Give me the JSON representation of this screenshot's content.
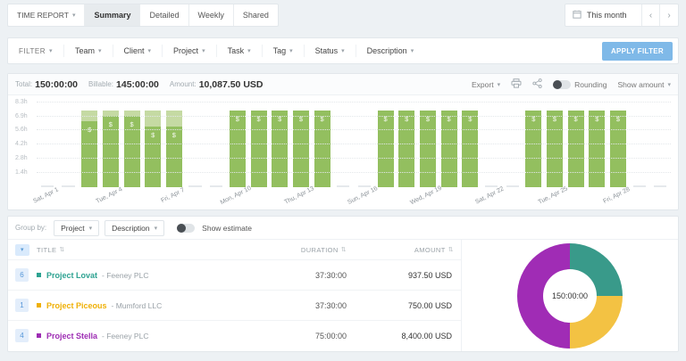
{
  "icons": {
    "chevron_down": "▾",
    "prev": "‹",
    "next": "›",
    "sort": "⇅"
  },
  "header": {
    "report_label": "TIME REPORT",
    "tabs": [
      {
        "label": "Summary",
        "active": true
      },
      {
        "label": "Detailed",
        "active": false
      },
      {
        "label": "Weekly",
        "active": false
      },
      {
        "label": "Shared",
        "active": false
      }
    ],
    "date_range": {
      "label": "This month"
    }
  },
  "filter_bar": {
    "filter_label": "FILTER",
    "filters": [
      "Team",
      "Client",
      "Project",
      "Task",
      "Tag",
      "Status",
      "Description"
    ],
    "apply_button": "APPLY FILTER"
  },
  "summary": {
    "total_label": "Total:",
    "total_value": "150:00:00",
    "billable_label": "Billable:",
    "billable_value": "145:00:00",
    "amount_label": "Amount:",
    "amount_value": "10,087.50 USD",
    "export_label": "Export",
    "rounding_label": "Rounding",
    "show_amount_label": "Show amount"
  },
  "group_bar": {
    "label": "Group by:",
    "selects": [
      "Project",
      "Description"
    ],
    "show_estimate_label": "Show estimate"
  },
  "table": {
    "columns": [
      "TITLE",
      "DURATION",
      "AMOUNT"
    ],
    "rows": [
      {
        "count": "6",
        "color": "#2da291",
        "name": "Project Lovat",
        "client": "- Feeney PLC",
        "duration": "37:30:00",
        "amount": "937.50 USD"
      },
      {
        "count": "1",
        "color": "#efb007",
        "name": "Project Piceous",
        "client": "- Mumford LLC",
        "duration": "37:30:00",
        "amount": "750.00 USD"
      },
      {
        "count": "4",
        "color": "#9d2cb3",
        "name": "Project Stella",
        "client": "- Feeney PLC",
        "duration": "75:00:00",
        "amount": "8,400.00 USD"
      }
    ]
  },
  "chart_data": [
    {
      "type": "bar",
      "stacked": true,
      "title": "Tracked time per day, April",
      "bar_symbol": "$",
      "x": [
        "Apr 1",
        "Apr 2",
        "Apr 3",
        "Apr 4",
        "Apr 5",
        "Apr 6",
        "Apr 7",
        "Apr 8",
        "Apr 9",
        "Apr 10",
        "Apr 11",
        "Apr 12",
        "Apr 13",
        "Apr 14",
        "Apr 15",
        "Apr 16",
        "Apr 17",
        "Apr 18",
        "Apr 19",
        "Apr 20",
        "Apr 21",
        "Apr 22",
        "Apr 23",
        "Apr 24",
        "Apr 25",
        "Apr 26",
        "Apr 27",
        "Apr 28",
        "Apr 29",
        "Apr 30"
      ],
      "series": [
        {
          "name": "billable",
          "color": "#93bf5f",
          "values": [
            0,
            0,
            6.5,
            7,
            7,
            6,
            6,
            0,
            0,
            7.5,
            7.5,
            7.5,
            7.5,
            7.5,
            0,
            0,
            7.5,
            7.5,
            7.5,
            7.5,
            7.5,
            0,
            0,
            7.5,
            7.5,
            7.5,
            7.5,
            7.5,
            0,
            0
          ]
        },
        {
          "name": "non-billable",
          "color": "#c5daa3",
          "values": [
            0,
            0,
            1,
            0.5,
            0.5,
            1.5,
            1.5,
            0,
            0,
            0,
            0,
            0,
            0,
            0,
            0,
            0,
            0,
            0,
            0,
            0,
            0,
            0,
            0,
            0,
            0,
            0,
            0,
            0,
            0,
            0
          ]
        }
      ],
      "ylim": [
        0,
        8.33
      ],
      "yticks": [
        {
          "value": 1.4,
          "label": "1.4h"
        },
        {
          "value": 2.8,
          "label": "2.8h"
        },
        {
          "value": 4.2,
          "label": "4.2h"
        },
        {
          "value": 5.6,
          "label": "5.6h"
        },
        {
          "value": 6.9,
          "label": "6.9h"
        },
        {
          "value": 8.3,
          "label": "8.3h"
        }
      ],
      "xticks": [
        {
          "index": 0,
          "label": "Sat, Apr 1"
        },
        {
          "index": 3,
          "label": "Tue, Apr 4"
        },
        {
          "index": 6,
          "label": "Fri, Apr 7"
        },
        {
          "index": 9,
          "label": "Mon, Apr 10"
        },
        {
          "index": 12,
          "label": "Thu, Apr 13"
        },
        {
          "index": 15,
          "label": "Sun, Apr 16"
        },
        {
          "index": 18,
          "label": "Wed, Apr 19"
        },
        {
          "index": 21,
          "label": "Sat, Apr 22"
        },
        {
          "index": 24,
          "label": "Tue, Apr 25"
        },
        {
          "index": 27,
          "label": "Fri, Apr 28"
        }
      ],
      "grid": true,
      "legend": false
    },
    {
      "type": "pie",
      "center_label": "150:00:00",
      "slices": [
        {
          "name": "Project Lovat",
          "value": 37.5,
          "color": "#399a8a"
        },
        {
          "name": "Project Piceous",
          "value": 37.5,
          "color": "#f3c243"
        },
        {
          "name": "Project Stella",
          "value": 75,
          "color": "#a02cb5"
        }
      ],
      "start_angle_deg": 0,
      "donut": true
    }
  ]
}
